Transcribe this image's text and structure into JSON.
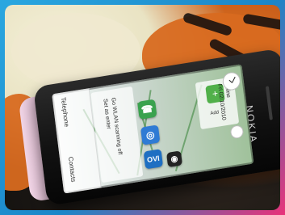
{
  "device": {
    "brand": "NOKIA"
  },
  "screen": {
    "left_column": {
      "phone_label": "Telephone",
      "contacts_label": "Contacts"
    },
    "task_card": {
      "line1": "Set as enter",
      "line2": "Go WLAN scanning off"
    },
    "profile": {
      "line1": "offline",
      "line2": "Fri 02/10/2010",
      "add_label": "Add"
    },
    "icons": [
      {
        "name": "phone-icon",
        "symbol": "☎"
      },
      {
        "name": "globe-icon",
        "symbol": "◎"
      },
      {
        "name": "ovi-icon",
        "symbol": "OVI"
      },
      {
        "name": "camera-icon",
        "symbol": "◉"
      }
    ]
  }
}
